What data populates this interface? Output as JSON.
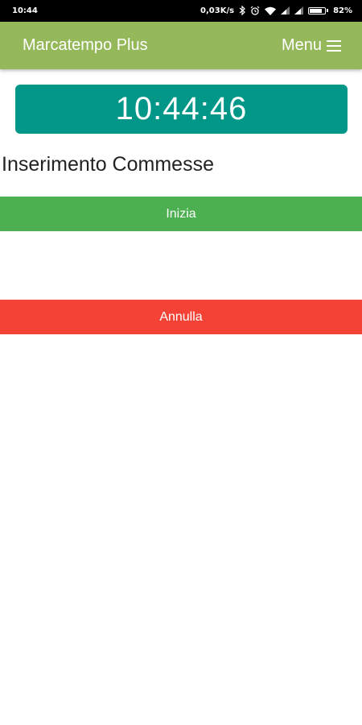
{
  "status_bar": {
    "time": "10:44",
    "network_speed": "0,03K/s",
    "battery_percent": "82%",
    "battery_level": 0.82,
    "icons": [
      "bluetooth-icon",
      "alarm-icon",
      "wifi-icon",
      "signal-icon",
      "signal-icon",
      "battery-icon"
    ]
  },
  "app_bar": {
    "title": "Marcatempo Plus",
    "menu_label": "Menu",
    "background_color": "#95b85b"
  },
  "clock": {
    "time": "10:44:46",
    "background_color": "#009688"
  },
  "section": {
    "title": "Inserimento Commesse"
  },
  "actions": {
    "start_label": "Inizia",
    "start_color": "#4caf50",
    "cancel_label": "Annulla",
    "cancel_color": "#f44336"
  }
}
